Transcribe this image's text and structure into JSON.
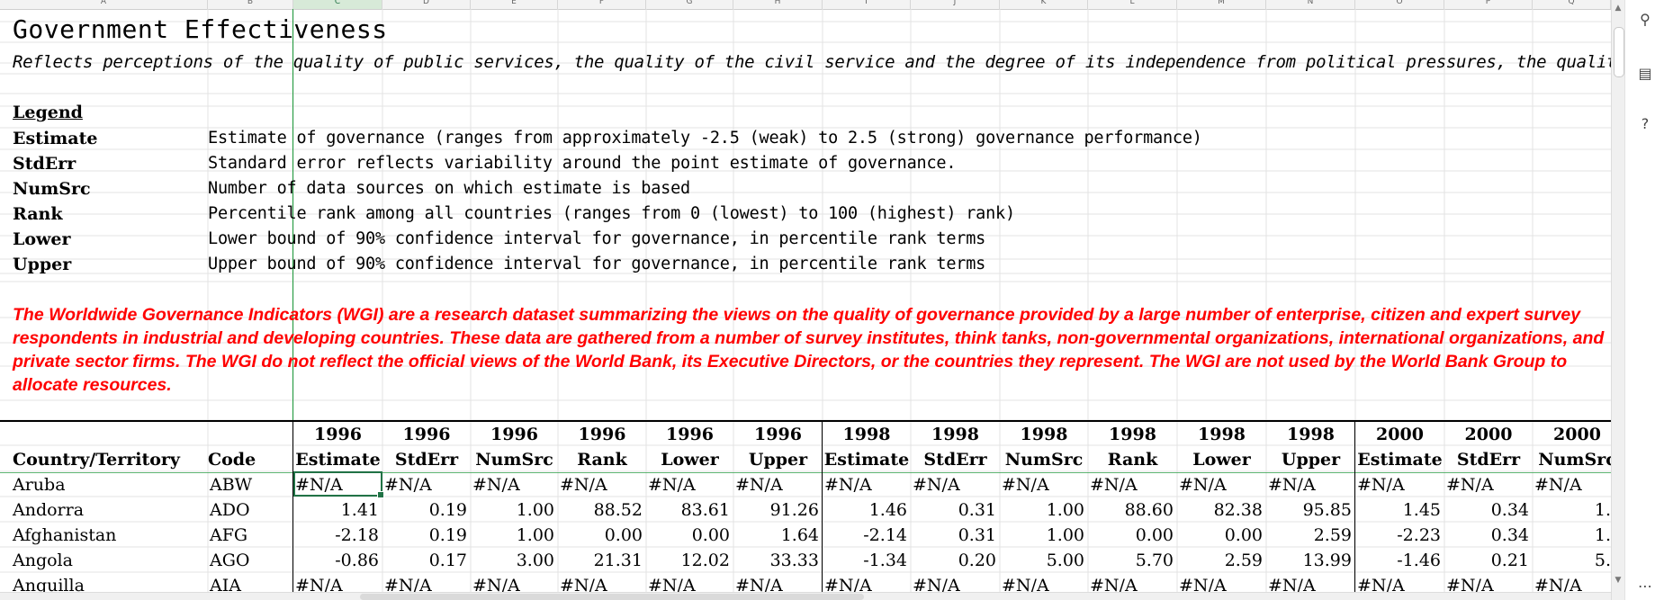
{
  "spreadsheet": {
    "column_letters": [
      "A",
      "B",
      "C",
      "D",
      "E",
      "F",
      "G",
      "H",
      "I",
      "J",
      "K",
      "L",
      "M",
      "N",
      "O",
      "P",
      "Q"
    ],
    "title": "Government Effectiveness",
    "subtitle": "Reflects perceptions of the quality of public services, the quality of the civil service and the degree of its independence from political pressures, the quality",
    "legend": {
      "heading": "Legend",
      "items": [
        {
          "key": "Estimate",
          "desc": "Estimate of governance (ranges from approximately -2.5 (weak) to 2.5 (strong) governance performance)"
        },
        {
          "key": "StdErr",
          "desc": "Standard error reflects variability around the point estimate of governance."
        },
        {
          "key": "NumSrc",
          "desc": "Number of data sources on which estimate is based"
        },
        {
          "key": "Rank",
          "desc": "Percentile rank among all countries (ranges from 0 (lowest) to 100 (highest) rank)"
        },
        {
          "key": "Lower",
          "desc": "Lower bound of 90% confidence interval for governance, in percentile rank terms"
        },
        {
          "key": "Upper",
          "desc": "Upper bound of 90% confidence interval for governance, in percentile rank terms"
        }
      ]
    },
    "disclaimer": "The Worldwide Governance Indicators (WGI) are a research dataset summarizing the views on the quality of governance provided by a large number of enterprise, citizen and expert survey respondents in industrial and developing countries. These data are gathered from a number of survey institutes, think tanks, non-governmental organizations, international organizations, and private sector firms. The WGI do not reflect the official views of the World Bank, its Executive Directors, or the countries they represent. The WGI are not used by the World Bank Group to allocate resources.",
    "table": {
      "header_col1": "Country/Territory",
      "header_col2": "Code",
      "years": [
        "1996",
        "1996",
        "1996",
        "1996",
        "1996",
        "1996",
        "1998",
        "1998",
        "1998",
        "1998",
        "1998",
        "1998",
        "2000",
        "2000",
        "2000"
      ],
      "metrics": [
        "Estimate",
        "StdErr",
        "NumSrc",
        "Rank",
        "Lower",
        "Upper",
        "Estimate",
        "StdErr",
        "NumSrc",
        "Rank",
        "Lower",
        "Upper",
        "Estimate",
        "StdErr",
        "NumSrc"
      ],
      "rows": [
        {
          "country": "Aruba",
          "code": "ABW",
          "values": [
            "#N/A",
            "#N/A",
            "#N/A",
            "#N/A",
            "#N/A",
            "#N/A",
            "#N/A",
            "#N/A",
            "#N/A",
            "#N/A",
            "#N/A",
            "#N/A",
            "#N/A",
            "#N/A",
            "#N/A"
          ]
        },
        {
          "country": "Andorra",
          "code": "ADO",
          "values": [
            "1.41",
            "0.19",
            "1.00",
            "88.52",
            "83.61",
            "91.26",
            "1.46",
            "0.31",
            "1.00",
            "88.60",
            "82.38",
            "95.85",
            "1.45",
            "0.34",
            "1."
          ]
        },
        {
          "country": "Afghanistan",
          "code": "AFG",
          "values": [
            "-2.18",
            "0.19",
            "1.00",
            "0.00",
            "0.00",
            "1.64",
            "-2.14",
            "0.31",
            "1.00",
            "0.00",
            "0.00",
            "2.59",
            "-2.23",
            "0.34",
            "1."
          ]
        },
        {
          "country": "Angola",
          "code": "AGO",
          "values": [
            "-0.86",
            "0.17",
            "3.00",
            "21.31",
            "12.02",
            "33.33",
            "-1.34",
            "0.20",
            "5.00",
            "5.70",
            "2.59",
            "13.99",
            "-1.46",
            "0.21",
            "5."
          ]
        },
        {
          "country": "Anguilla",
          "code": "AIA",
          "values": [
            "#N/A",
            "#N/A",
            "#N/A",
            "#N/A",
            "#N/A",
            "#N/A",
            "#N/A",
            "#N/A",
            "#N/A",
            "#N/A",
            "#N/A",
            "#N/A",
            "#N/A",
            "#N/A",
            "#N/A"
          ]
        }
      ]
    }
  }
}
